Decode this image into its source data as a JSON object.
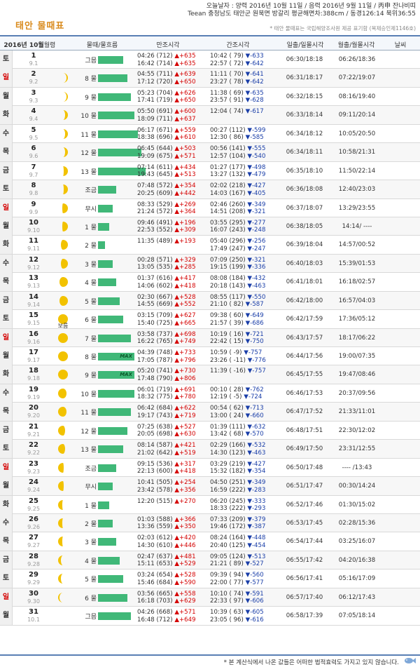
{
  "header": {
    "line1": "오늘날자 : 양력 2016년 10월 11일 / 음력 2016년 9월 11일 / 丙申 잔나비띠",
    "line2": "Teean 충청남도 태안군 원북면 방갈리 평균해면차:388cm / 동경126:14 북위36:55",
    "title": "태안 물때표",
    "note": "* 태안 물때표는 국립해양조사원 제공 표기함 (복제승인제1146호)"
  },
  "columns": {
    "month": "2016년 10월",
    "day": "월령",
    "tide": "물때/물흐름",
    "high": "만조시각",
    "low": "간조시각",
    "sun": "일출/일몰시각",
    "moon": "월출/월몰시각",
    "weather": "날씨"
  },
  "rows": [
    {
      "dow": "토",
      "type": "sat",
      "d": "1",
      "l": "9.1",
      "ph": 0,
      "ml": "",
      "mul": "그믐",
      "bar": 7,
      "max": "",
      "h1": "04:26 (712)",
      "h1c": "▲+635",
      "h2": "16:42 (714)",
      "h2c": "▲+635",
      "l1": "10:42 ( 79)",
      "l1c": "▼-633",
      "l2": "22:57 ( 72)",
      "l2c": "▼-642",
      "sun": "06:30/18:18",
      "moon": "06:26/18:36"
    },
    {
      "dow": "일",
      "type": "sun",
      "d": "2",
      "l": "9.2",
      "ph": 1,
      "ml": "",
      "mul": "8 물",
      "bar": 8,
      "max": "",
      "h1": "04:55 (711)",
      "h1c": "▲+639",
      "h2": "17:12 (720)",
      "h2c": "▲+650",
      "l1": "11:11 ( 70)",
      "l1c": "▼-641",
      "l2": "23:27 ( 78)",
      "l2c": "▼-642",
      "sun": "06:31/18:17",
      "moon": "07:22/19:07"
    },
    {
      "dow": "월",
      "type": "wk",
      "d": "3",
      "l": "9.3",
      "ph": 1,
      "ml": "",
      "mul": "9 물",
      "bar": 9,
      "max": "",
      "h1": "05:23 (704)",
      "h1c": "▲+626",
      "h2": "17:41 (719)",
      "h2c": "▲+650",
      "l1": "11:38 ( 69)",
      "l1c": "▼-635",
      "l2": "23:57 ( 91)",
      "l2c": "▼-628",
      "sun": "06:32/18:15",
      "moon": "08:16/19:40"
    },
    {
      "dow": "화",
      "type": "wk",
      "d": "4",
      "l": "9.4",
      "ph": 2,
      "ml": "",
      "mul": "10 물",
      "bar": 10,
      "max": "",
      "h1": "05:50 (691)",
      "h1c": "▲+600",
      "h2": "18:09 (711)",
      "h2c": "▲+637",
      "l1": "12:04 ( 74)",
      "l1c": "▼-617",
      "l2": "",
      "l2c": "",
      "sun": "06:33/18:14",
      "moon": "09:11/20:14"
    },
    {
      "dow": "수",
      "type": "wk",
      "d": "5",
      "l": "9.5",
      "ph": 2,
      "ml": "",
      "mul": "11 물",
      "bar": 11,
      "max": "",
      "h1": "06:17 (671)",
      "h1c": "▲+559",
      "h2": "18:38 (696)",
      "h2c": "▲+610",
      "l1": "00:27 (112)",
      "l1c": "▼-599",
      "l2": "12:30 ( 86)",
      "l2c": "▼-585",
      "sun": "06:34/18:12",
      "moon": "10:05/20:50"
    },
    {
      "dow": "목",
      "type": "wk",
      "d": "6",
      "l": "9.6",
      "ph": 2,
      "ml": "",
      "mul": "12 물",
      "bar": 12,
      "max": "",
      "h1": "06:45 (644)",
      "h1c": "▲+503",
      "h2": "19:09 (675)",
      "h2c": "▲+571",
      "l1": "00:56 (141)",
      "l1c": "▼-555",
      "l2": "12:57 (104)",
      "l2c": "▼-540",
      "sun": "06:34/18:11",
      "moon": "10:58/21:31"
    },
    {
      "dow": "금",
      "type": "wk",
      "d": "7",
      "l": "9.7",
      "ph": 3,
      "ml": "",
      "mul": "13 물",
      "bar": 13,
      "max": "",
      "h1": "07:14 (611)",
      "h1c": "▲+434",
      "h2": "19:43 (645)",
      "h2c": "▲+513",
      "l1": "01:27 (177)",
      "l1c": "▼-498",
      "l2": "13:27 (132)",
      "l2c": "▼-479",
      "sun": "06:35/18:10",
      "moon": "11:50/22:14"
    },
    {
      "dow": "토",
      "type": "sat",
      "d": "8",
      "l": "9.8",
      "ph": 3,
      "ml": "",
      "mul": "조금",
      "bar": 5,
      "max": "",
      "h1": "07:48 (572)",
      "h1c": "▲+354",
      "h2": "20:25 (609)",
      "h2c": "▲+442",
      "l1": "02:02 (218)",
      "l1c": "▼-427",
      "l2": "14:03 (167)",
      "l2c": "▼-405",
      "sun": "06:36/18:08",
      "moon": "12:40/23:03"
    },
    {
      "dow": "일",
      "type": "sun",
      "d": "9",
      "l": "9.9",
      "ph": 4,
      "ml": "",
      "mul": "무시",
      "bar": 4,
      "max": "",
      "h1": "08:33 (529)",
      "h1c": "▲+269",
      "h2": "21:24 (572)",
      "h2c": "▲+364",
      "l1": "02:46 (260)",
      "l1c": "▼-349",
      "l2": "14:51 (208)",
      "l2c": "▼-321",
      "sun": "06:37/18:07",
      "moon": "13:29/23:55"
    },
    {
      "dow": "월",
      "type": "wk",
      "d": "10",
      "l": "9.10",
      "ph": 4,
      "ml": "",
      "mul": "1 물",
      "bar": 3,
      "max": "",
      "h1": "09:46 (491)",
      "h1c": "▲+196",
      "h2": "22:53 (552)",
      "h2c": "▲+309",
      "l1": "03:55 (295)",
      "l1c": "▼-277",
      "l2": "16:07 (243)",
      "l2c": "▼-248",
      "sun": "06:38/18:05",
      "moon": "14:14/ ----"
    },
    {
      "dow": "화",
      "type": "wk",
      "d": "11",
      "l": "9.11",
      "ph": 5,
      "ml": "",
      "mul": "2 물",
      "bar": 2,
      "max": "",
      "h1": "11:35 (489)",
      "h1c": "▲+193",
      "h2": "",
      "h2c": "",
      "l1": "05:40 (296)",
      "l1c": "▼-256",
      "l2": "17:49 (247)",
      "l2c": "▼-247",
      "sun": "06:39/18:04",
      "moon": "14:57/00:52"
    },
    {
      "dow": "수",
      "type": "wk",
      "d": "12",
      "l": "9.12",
      "ph": 5,
      "ml": "",
      "mul": "3 물",
      "bar": 4,
      "max": "",
      "h1": "00:28 (571)",
      "h1c": "▲+329",
      "h2": "13:05 (535)",
      "h2c": "▲+285",
      "l1": "07:09 (250)",
      "l1c": "▼-321",
      "l2": "19:15 (199)",
      "l2c": "▼-336",
      "sun": "06:40/18:03",
      "moon": "15:39/01:53"
    },
    {
      "dow": "목",
      "type": "wk",
      "d": "13",
      "l": "9.13",
      "ph": 6,
      "ml": "",
      "mul": "4 물",
      "bar": 5,
      "max": "",
      "h1": "01:37 (616)",
      "h1c": "▲+417",
      "h2": "14:06 (602)",
      "h2c": "▲+418",
      "l1": "08:08 (184)",
      "l1c": "▼-432",
      "l2": "20:18 (143)",
      "l2c": "▼-463",
      "sun": "06:41/18:01",
      "moon": "16:18/02:57"
    },
    {
      "dow": "금",
      "type": "wk",
      "d": "14",
      "l": "9.14",
      "ph": 6,
      "ml": "",
      "mul": "5 물",
      "bar": 6,
      "max": "",
      "h1": "02:30 (667)",
      "h1c": "▲+528",
      "h2": "14:55 (669)",
      "h2c": "▲+552",
      "l1": "08:55 (117)",
      "l1c": "▼-550",
      "l2": "21:10 ( 82)",
      "l2c": "▼-587",
      "sun": "06:42/18:00",
      "moon": "16:57/04:03"
    },
    {
      "dow": "토",
      "type": "sat",
      "d": "15",
      "l": "9.15",
      "ph": 7,
      "ml": "보름",
      "mul": "6 물",
      "bar": 7,
      "max": "",
      "h1": "03:15 (709)",
      "h1c": "▲+627",
      "h2": "15:40 (725)",
      "h2c": "▲+665",
      "l1": "09:38 ( 60)",
      "l1c": "▼-649",
      "l2": "21:57 ( 39)",
      "l2c": "▼-686",
      "sun": "06:42/17:59",
      "moon": "17:36/05:12"
    },
    {
      "dow": "일",
      "type": "sun",
      "d": "16",
      "l": "9.16",
      "ph": 7,
      "ml": "",
      "mul": "7 물",
      "bar": 9,
      "max": "",
      "h1": "03:58 (737)",
      "h1c": "▲+698",
      "h2": "16:22 (765)",
      "h2c": "▲+749",
      "l1": "10:19 ( 16)",
      "l1c": "▼-721",
      "l2": "22:42 ( 15)",
      "l2c": "▼-750",
      "sun": "06:43/17:57",
      "moon": "18:17/06:22"
    },
    {
      "dow": "월",
      "type": "wk",
      "d": "17",
      "l": "9.17",
      "ph": 7,
      "ml": "",
      "mul": "8 물",
      "bar": 10,
      "max": "MAX",
      "h1": "04:39 (748)",
      "h1c": "▲+733",
      "h2": "17:05 (787)",
      "h2c": "▲+796",
      "l1": "10:59 ( -9)",
      "l1c": "▼-757",
      "l2": "23:26 ( -11)",
      "l2c": "▼-776",
      "sun": "06:44/17:56",
      "moon": "19:00/07:35"
    },
    {
      "dow": "화",
      "type": "wk",
      "d": "18",
      "l": "9.18",
      "ph": 7,
      "ml": "",
      "mul": "9 물",
      "bar": 10,
      "max": "MAX",
      "h1": "05:20 (741)",
      "h1c": "▲+730",
      "h2": "17:48 (790)",
      "h2c": "▲+806",
      "l1": "11:39 ( -16)",
      "l1c": "▼-757",
      "l2": "",
      "l2c": "",
      "sun": "06:45/17:55",
      "moon": "19:47/08:46"
    },
    {
      "dow": "수",
      "type": "wk",
      "d": "19",
      "l": "9.19",
      "ph": 8,
      "ml": "",
      "mul": "10 물",
      "bar": 10,
      "max": "",
      "h1": "06:01 (719)",
      "h1c": "▲+691",
      "h2": "18:32 (775)",
      "h2c": "▲+780",
      "l1": "00:10 ( 28)",
      "l1c": "▼-762",
      "l2": "12:19 ( -5)",
      "l2c": "▼-724",
      "sun": "06:46/17:53",
      "moon": "20:37/09:56"
    },
    {
      "dow": "목",
      "type": "wk",
      "d": "20",
      "l": "9.20",
      "ph": 8,
      "ml": "",
      "mul": "11 물",
      "bar": 9,
      "max": "",
      "h1": "06:42 (684)",
      "h1c": "▲+622",
      "h2": "19:17 (743)",
      "h2c": "▲+719",
      "l1": "00:54 ( 62)",
      "l1c": "▼-713",
      "l2": "13:00 ( 24)",
      "l2c": "▼-660",
      "sun": "06:47/17:52",
      "moon": "21:33/11:01"
    },
    {
      "dow": "금",
      "type": "wk",
      "d": "21",
      "l": "9.21",
      "ph": 9,
      "ml": "",
      "mul": "12 물",
      "bar": 8,
      "max": "",
      "h1": "07:25 (638)",
      "h1c": "▲+527",
      "h2": "20:05 (698)",
      "h2c": "▲+630",
      "l1": "01:39 (111)",
      "l1c": "▼-632",
      "l2": "13:42 ( 68)",
      "l2c": "▼-570",
      "sun": "06:48/17:51",
      "moon": "22:30/12:02"
    },
    {
      "dow": "토",
      "type": "sat",
      "d": "22",
      "l": "9.22",
      "ph": 9,
      "ml": "",
      "mul": "13 물",
      "bar": 7,
      "max": "",
      "h1": "08:14 (587)",
      "h1c": "▲+421",
      "h2": "21:02 (642)",
      "h2c": "▲+519",
      "l1": "02:29 (166)",
      "l1c": "▼-532",
      "l2": "14:30 (123)",
      "l2c": "▼-463",
      "sun": "06:49/17:50",
      "moon": "23:31/12:55"
    },
    {
      "dow": "일",
      "type": "sun",
      "d": "23",
      "l": "9.23",
      "ph": 10,
      "ml": "",
      "mul": "조금",
      "bar": 5,
      "max": "",
      "h1": "09:15 (536)",
      "h1c": "▲+317",
      "h2": "22:13 (600)",
      "h2c": "▲+418",
      "l1": "03:29 (219)",
      "l1c": "▼-427",
      "l2": "15:32 (182)",
      "l2c": "▼-354",
      "sun": "06:50/17:48",
      "moon": "---- /13:43"
    },
    {
      "dow": "월",
      "type": "wk",
      "d": "24",
      "l": "9.24",
      "ph": 10,
      "ml": "",
      "mul": "무시",
      "bar": 4,
      "max": "",
      "h1": "10:41 (505)",
      "h1c": "▲+254",
      "h2": "23:42 (578)",
      "h2c": "▲+356",
      "l1": "04:50 (251)",
      "l1c": "▼-349",
      "l2": "16:59 (222)",
      "l2c": "▼-283",
      "sun": "06:51/17:47",
      "moon": "00:30/14:24"
    },
    {
      "dow": "화",
      "type": "wk",
      "d": "25",
      "l": "9.25",
      "ph": 11,
      "ml": "",
      "mul": "1 물",
      "bar": 3,
      "max": "",
      "h1": "12:20 (515)",
      "h1c": "▲+270",
      "h2": "",
      "h2c": "",
      "l1": "06:20 (245)",
      "l1c": "▼-333",
      "l2": "18:33 (222)",
      "l2c": "▼-293",
      "sun": "06:52/17:46",
      "moon": "01:30/15:02"
    },
    {
      "dow": "수",
      "type": "wk",
      "d": "26",
      "l": "9.26",
      "ph": 11,
      "ml": "",
      "mul": "2 물",
      "bar": 4,
      "max": "",
      "h1": "01:03 (588)",
      "h1c": "▲+366",
      "h2": "13:36 (559)",
      "h2c": "▲+350",
      "l1": "07:33 (209)",
      "l1c": "▼-379",
      "l2": "19:46 (172)",
      "l2c": "▼-387",
      "sun": "06:53/17:45",
      "moon": "02:28/15:36"
    },
    {
      "dow": "목",
      "type": "wk",
      "d": "27",
      "l": "9.27",
      "ph": 11,
      "ml": "",
      "mul": "3 물",
      "bar": 5,
      "max": "",
      "h1": "02:03 (612)",
      "h1c": "▲+420",
      "h2": "14:30 (610)",
      "h2c": "▲+446",
      "l1": "08:24 (164)",
      "l1c": "▼-448",
      "l2": "20:40 (125)",
      "l2c": "▼-454",
      "sun": "06:54/17:44",
      "moon": "03:25/16:07"
    },
    {
      "dow": "금",
      "type": "wk",
      "d": "28",
      "l": "9.28",
      "ph": 12,
      "ml": "",
      "mul": "4 물",
      "bar": 6,
      "max": "",
      "h1": "02:47 (637)",
      "h1c": "▲+481",
      "h2": "15:11 (653)",
      "h2c": "▲+529",
      "l1": "09:05 (124)",
      "l1c": "▼-513",
      "l2": "21:21 ( 89)",
      "l2c": "▼-527",
      "sun": "06:55/17:42",
      "moon": "04:20/16:38"
    },
    {
      "dow": "토",
      "type": "sat",
      "d": "29",
      "l": "9.29",
      "ph": 12,
      "ml": "",
      "mul": "5 물",
      "bar": 7,
      "max": "",
      "h1": "03:24 (654)",
      "h1c": "▲+528",
      "h2": "15:46 (684)",
      "h2c": "▲+590",
      "l1": "09:39 ( 94)",
      "l1c": "▼-560",
      "l2": "22:00 ( 77)",
      "l2c": "▼-577",
      "sun": "06:56/17:41",
      "moon": "05:16/17:09"
    },
    {
      "dow": "일",
      "type": "sun",
      "d": "30",
      "l": "9.30",
      "ph": 13,
      "ml": "",
      "mul": "6 물",
      "bar": 8,
      "max": "",
      "h1": "03:56 (665)",
      "h1c": "▲+558",
      "h2": "16:18 (703)",
      "h2c": "▲+629",
      "l1": "10:10 ( 74)",
      "l1c": "▼-591",
      "l2": "22:33 ( 97)",
      "l2c": "▼-606",
      "sun": "06:57/17:40",
      "moon": "06:12/17:43"
    },
    {
      "dow": "월",
      "type": "wk",
      "d": "31",
      "l": "10.1",
      "ph": 0,
      "ml": "",
      "mul": "그믐",
      "bar": 9,
      "max": "",
      "h1": "04:26 (668)",
      "h1c": "▲+571",
      "h2": "16:48 (712)",
      "h2c": "▲+649",
      "l1": "10:39 ( 63)",
      "l1c": "▼-605",
      "l2": "23:05 ( 96)",
      "l2c": "▼-616",
      "sun": "06:58/17:39",
      "moon": "07:05/18:14"
    }
  ],
  "footer": {
    "note": "* 본 계산식에서 나온 값들은 어떠한 법적효력도 가지고 있지 않습니다."
  }
}
